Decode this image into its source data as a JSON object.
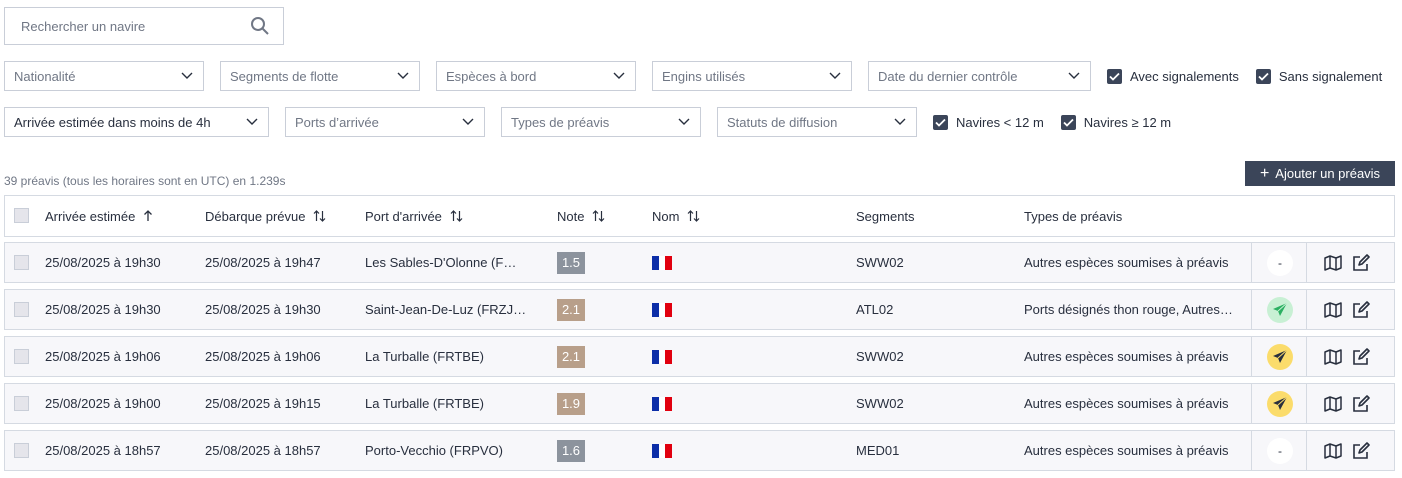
{
  "search": {
    "placeholder": "Rechercher un navire"
  },
  "filters_row1": [
    {
      "label": "Nationalité",
      "filled": false
    },
    {
      "label": "Segments de flotte",
      "filled": false
    },
    {
      "label": "Espèces à bord",
      "filled": false
    },
    {
      "label": "Engins utilisés",
      "filled": false
    },
    {
      "label": "Date du dernier contrôle",
      "filled": false
    }
  ],
  "checkboxes_row1": [
    {
      "label": "Avec signalements",
      "checked": true
    },
    {
      "label": "Sans signalement",
      "checked": true
    }
  ],
  "filters_row2": [
    {
      "label": "Arrivée estimée dans moins de 4h",
      "filled": true
    },
    {
      "label": "Ports d’arrivée",
      "filled": false
    },
    {
      "label": "Types de préavis",
      "filled": false
    },
    {
      "label": "Statuts de diffusion",
      "filled": false
    }
  ],
  "checkboxes_row2": [
    {
      "label": "Navires < 12 m",
      "checked": true
    },
    {
      "label": "Navires ≥ 12 m",
      "checked": true
    }
  ],
  "count_text": "39 préavis (tous les horaires sont en UTC) en 1.239s",
  "add_button": "Ajouter un préavis",
  "columns": {
    "arrival": "Arrivée estimée",
    "landing": "Débarque prévue",
    "port": "Port d'arrivée",
    "note": "Note",
    "name": "Nom",
    "segments": "Segments",
    "types": "Types de préavis"
  },
  "colors": {
    "note_grey": "#8c939d",
    "note_brown": "#b89f8a",
    "status_green": "#c8f0d4",
    "status_yellow": "#fbdc6b",
    "status_white": "#ffffff",
    "dark": "#3b4559"
  },
  "rows": [
    {
      "arrival": "25/08/2025 à 19h30",
      "landing": "25/08/2025 à 19h47",
      "port": "Les Sables-D'Olonne (F…",
      "note": "1.5",
      "note_color": "grey",
      "flag": "france-flag",
      "name": "",
      "segments": "SWW02",
      "types": "Autres espèces soumises à préavis",
      "status": "-",
      "status_kind": "none"
    },
    {
      "arrival": "25/08/2025 à 19h30",
      "landing": "25/08/2025 à 19h30",
      "port": "Saint-Jean-De-Luz (FRZJ…",
      "note": "2.1",
      "note_color": "brown",
      "flag": "france-flag",
      "name": "",
      "segments": "ATL02",
      "types": "Ports désignés thon rouge, Autres…",
      "status": "",
      "status_kind": "green"
    },
    {
      "arrival": "25/08/2025 à 19h06",
      "landing": "25/08/2025 à 19h06",
      "port": "La Turballe (FRTBE)",
      "note": "2.1",
      "note_color": "brown",
      "flag": "france-flag",
      "name": "",
      "segments": "SWW02",
      "types": "Autres espèces soumises à préavis",
      "status": "",
      "status_kind": "yellow"
    },
    {
      "arrival": "25/08/2025 à 19h00",
      "landing": "25/08/2025 à 19h15",
      "port": "La Turballe (FRTBE)",
      "note": "1.9",
      "note_color": "brown",
      "flag": "france-flag",
      "name": "",
      "segments": "SWW02",
      "types": "Autres espèces soumises à préavis",
      "status": "",
      "status_kind": "yellow"
    },
    {
      "arrival": "25/08/2025 à 18h57",
      "landing": "25/08/2025 à 18h57",
      "port": "Porto-Vecchio (FRPVO)",
      "note": "1.6",
      "note_color": "grey",
      "flag": "france-flag",
      "name": "",
      "segments": "MED01",
      "types": "Autres espèces soumises à préavis",
      "status": "-",
      "status_kind": "none"
    }
  ]
}
